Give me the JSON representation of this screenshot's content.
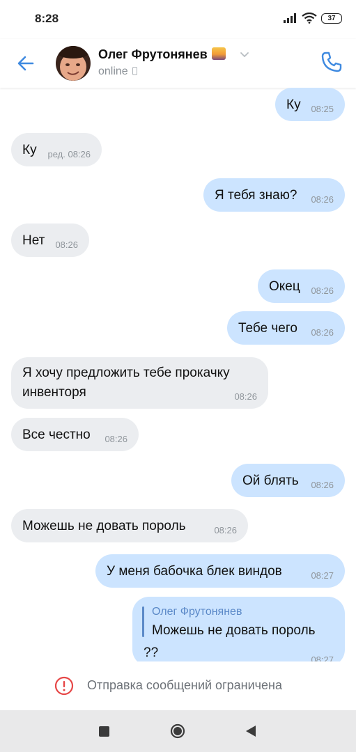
{
  "status": {
    "time": "8:28",
    "battery": "37"
  },
  "header": {
    "contact_name": "Олег Фрутонянев",
    "presence": "online"
  },
  "messages": [
    {
      "dir": "out",
      "text": "Ку",
      "time": "08:25"
    },
    {
      "dir": "in",
      "text": "Ку",
      "time": "ред. 08:26"
    },
    {
      "dir": "out",
      "text": "Я тебя знаю?",
      "time": "08:26"
    },
    {
      "dir": "in",
      "text": "Нет",
      "time": "08:26"
    },
    {
      "dir": "out",
      "text": "Окец",
      "time": "08:26"
    },
    {
      "dir": "out",
      "text": "Тебе чего",
      "time": "08:26"
    },
    {
      "dir": "in",
      "text_lines": [
        "Я хочу предложить тебе прокачку",
        "инвенторя"
      ],
      "time": "08:26"
    },
    {
      "dir": "in",
      "text": "Все честно",
      "time": "08:26"
    },
    {
      "dir": "out",
      "text": "Ой блять",
      "time": "08:26"
    },
    {
      "dir": "in",
      "text": "Можешь не довать пороль",
      "time": "08:26"
    },
    {
      "dir": "out",
      "text": "У меня бабочка блек виндов",
      "time": "08:27"
    },
    {
      "dir": "out",
      "reply_to": {
        "name": "Олег Фрутонянев",
        "text": "Можешь не довать пороль"
      },
      "text": "??",
      "time": "08:27"
    }
  ],
  "footer": {
    "restriction_text": "Отправка сообщений ограничена"
  },
  "icons": {
    "back": "arrow-left-icon",
    "call": "phone-icon",
    "expand": "chevron-down-icon",
    "warning": "exclamation-circle-icon",
    "device": "mobile-device-icon",
    "emoji": "sunset-emoji-icon"
  },
  "colors": {
    "accent": "#3f8ae0",
    "incoming_bubble": "#ebedf0",
    "outgoing_bubble": "#cce4ff",
    "warning": "#e64646"
  }
}
